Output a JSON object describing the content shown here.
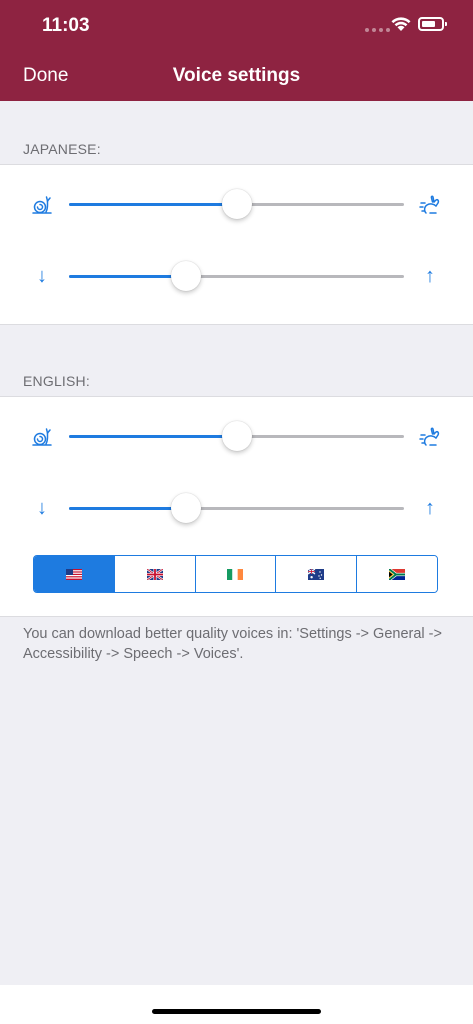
{
  "status_bar": {
    "time": "11:03"
  },
  "nav": {
    "done_label": "Done",
    "title": "Voice settings"
  },
  "sections": [
    {
      "header": "JAPANESE:",
      "speed": 0.5,
      "pitch": 0.35
    },
    {
      "header": "ENGLISH:",
      "speed": 0.5,
      "pitch": 0.35,
      "accents": [
        {
          "flag": "us-flag",
          "selected": true
        },
        {
          "flag": "uk-flag",
          "selected": false
        },
        {
          "flag": "ireland-flag",
          "selected": false
        },
        {
          "flag": "australia-flag",
          "selected": false
        },
        {
          "flag": "south-africa-flag",
          "selected": false
        }
      ]
    }
  ],
  "footer_note": "You can download better quality voices in: 'Settings -> General -> Accessibility -> Speech -> Voices'.",
  "icons": {
    "slow": "snail-icon",
    "fast": "rabbit-icon",
    "pitch_down": "↓",
    "pitch_up": "↑"
  },
  "colors": {
    "accent": "#1E7BE0",
    "brand": "#8E2341",
    "background": "#EFEFF4"
  }
}
